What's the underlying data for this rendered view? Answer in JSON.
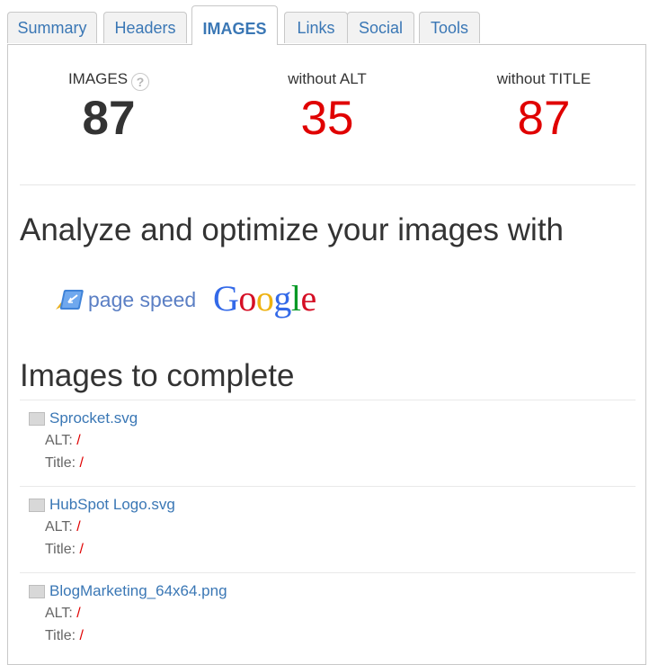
{
  "tabs": [
    {
      "label": "Summary",
      "active": false
    },
    {
      "label": "Headers",
      "active": false
    },
    {
      "label": "IMAGES",
      "active": true
    },
    {
      "label": "Links",
      "active": false
    },
    {
      "label": "Social",
      "active": false
    },
    {
      "label": "Tools",
      "active": false
    }
  ],
  "stats": {
    "images": {
      "label": "IMAGES",
      "value": "87",
      "help": "?"
    },
    "without_alt": {
      "label": "without ALT",
      "value": "35"
    },
    "without_title": {
      "label": "without TITLE",
      "value": "87"
    }
  },
  "colors": {
    "accent": "#3a77b5",
    "error": "#e00000"
  },
  "analyze": {
    "heading": "Analyze and optimize your images with",
    "pagespeed_text": "page speed",
    "google_text": "Google"
  },
  "images_section": {
    "heading": "Images to complete",
    "alt_label": "ALT:",
    "title_label": "Title:",
    "items": [
      {
        "name": "Sprocket.svg",
        "alt": "/",
        "title": "/"
      },
      {
        "name": "HubSpot Logo.svg",
        "alt": "/",
        "title": "/"
      },
      {
        "name": "BlogMarketing_64x64.png",
        "alt": "/",
        "title": "/"
      }
    ]
  }
}
